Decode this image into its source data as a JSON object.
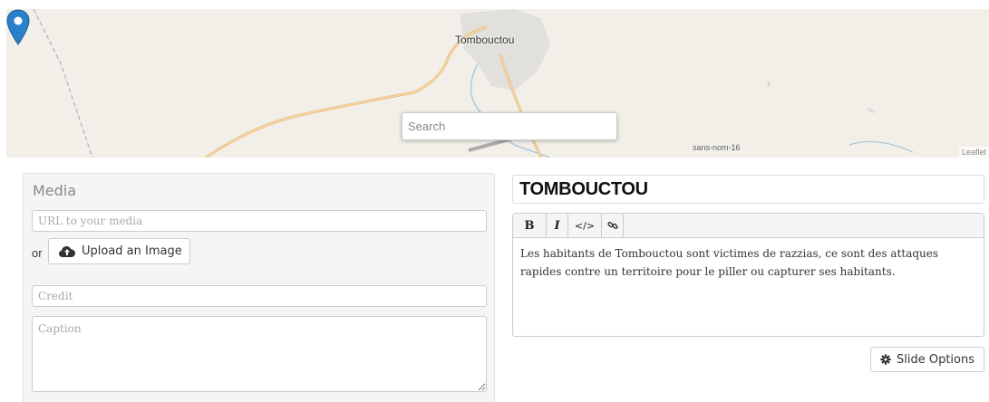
{
  "map": {
    "city_label": "Tombouctou",
    "area_label": "sans-nom-16",
    "attribution": "Leaflet",
    "search_placeholder": "Search",
    "marker_color": "#2a81cb"
  },
  "media": {
    "title": "Media",
    "url_placeholder": "URL to your media",
    "or_label": "or",
    "upload_label": "Upload an Image",
    "credit_placeholder": "Credit",
    "caption_placeholder": "Caption"
  },
  "slide": {
    "title": "TOMBOUCTOU",
    "toolbar": {
      "bold": "B",
      "italic": "I",
      "code": "</>",
      "link": "%"
    },
    "body": "Les habitants de Tombouctou sont victimes de razzias, ce sont des attaques rapides contre un territoire pour le piller ou capturer ses habitants.",
    "options_label": "Slide Options"
  },
  "icons": {
    "upload": "cloud-upload-icon",
    "options": "gear-icon",
    "marker": "map-marker-icon"
  }
}
